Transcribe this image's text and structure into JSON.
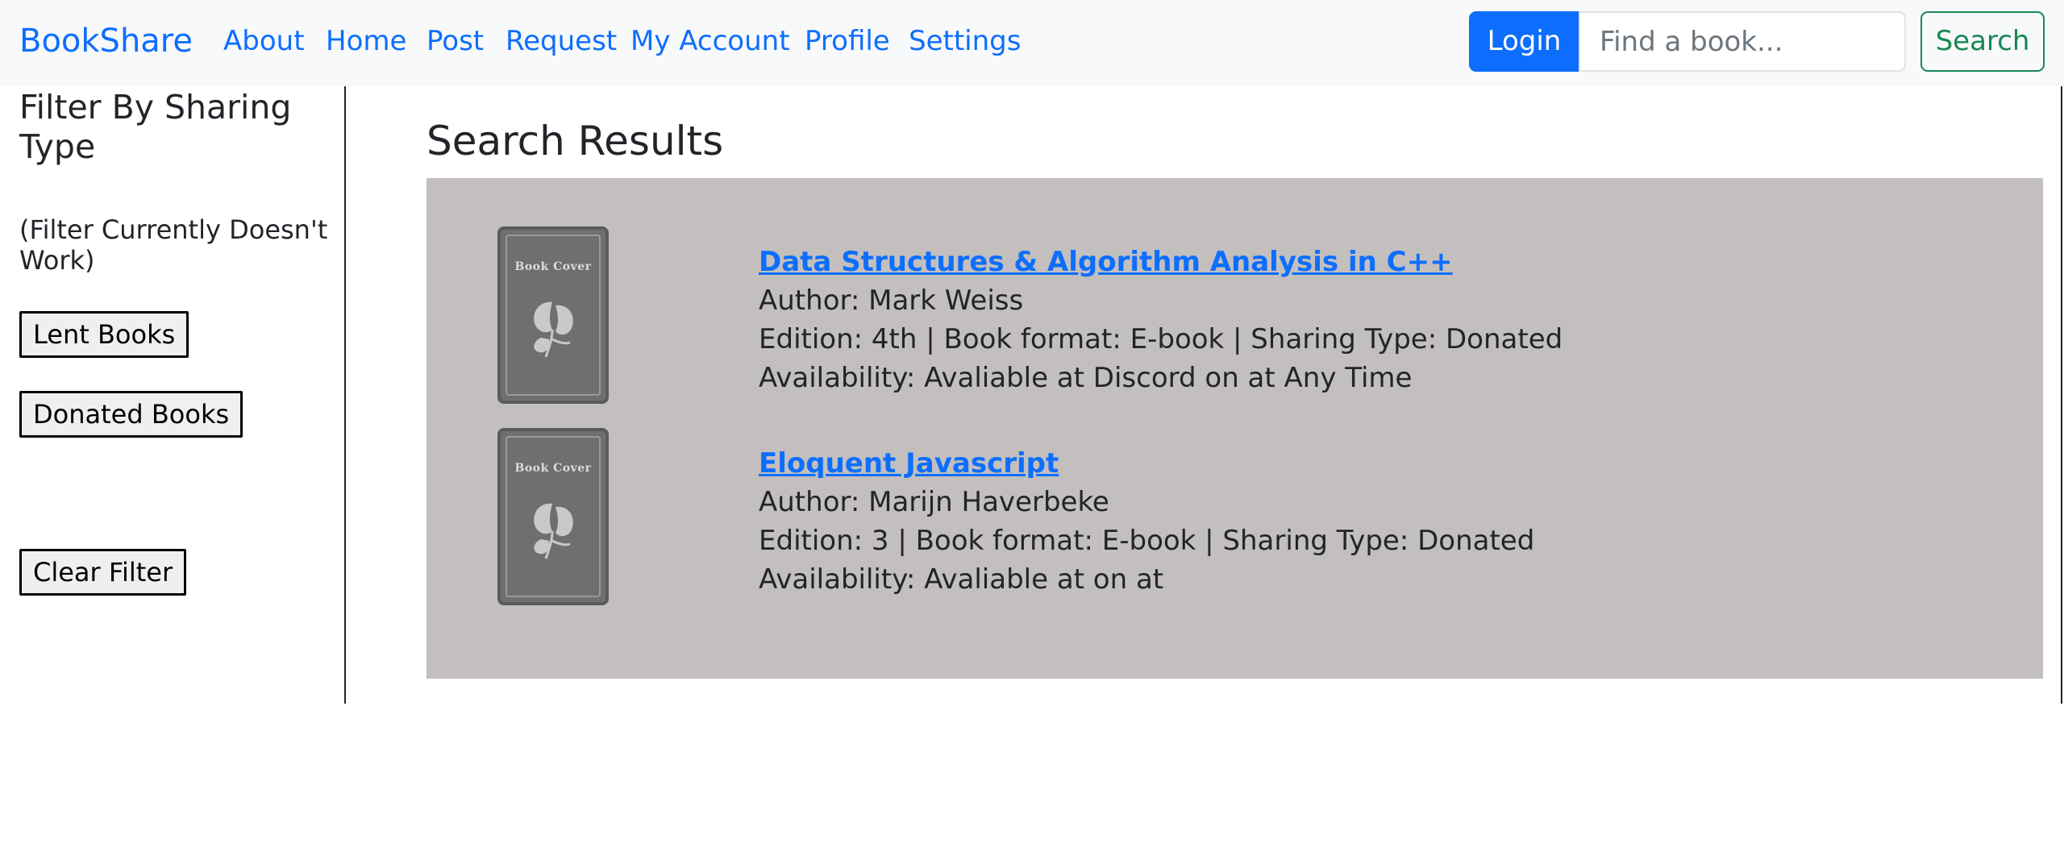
{
  "navbar": {
    "brand": "BookShare",
    "links": [
      "About",
      "Home",
      "Post",
      "Request",
      "My Account",
      "Profile",
      "Settings"
    ],
    "login_label": "Login",
    "search_placeholder": "Find a book...",
    "search_label": "Search"
  },
  "sidebar": {
    "title": "Filter By Sharing Type",
    "note": "(Filter Currently Doesn't Work)",
    "lent_label": "Lent Books",
    "donated_label": "Donated Books",
    "clear_label": "Clear Filter"
  },
  "main": {
    "title": "Search Results",
    "cover_text": "Book Cover",
    "results": [
      {
        "title": "Data Structures & Algorithm Analysis in C++",
        "author": "Author: Mark Weiss",
        "details": "Edition: 4th | Book format: E-book | Sharing Type: Donated",
        "availability": "Availability: Avaliable at Discord on at Any Time"
      },
      {
        "title": "Eloquent Javascript",
        "author": "Author: Marijn Haverbeke",
        "details": "Edition: 3 | Book format: E-book | Sharing Type: Donated",
        "availability": "Availability: Avaliable at on at"
      }
    ]
  },
  "colors": {
    "primary": "#0d6efd",
    "success": "#198754",
    "navbar_bg": "#f8f9fa",
    "results_bg": "#c2bfbe",
    "cover_bg": "#6f6f6f"
  }
}
